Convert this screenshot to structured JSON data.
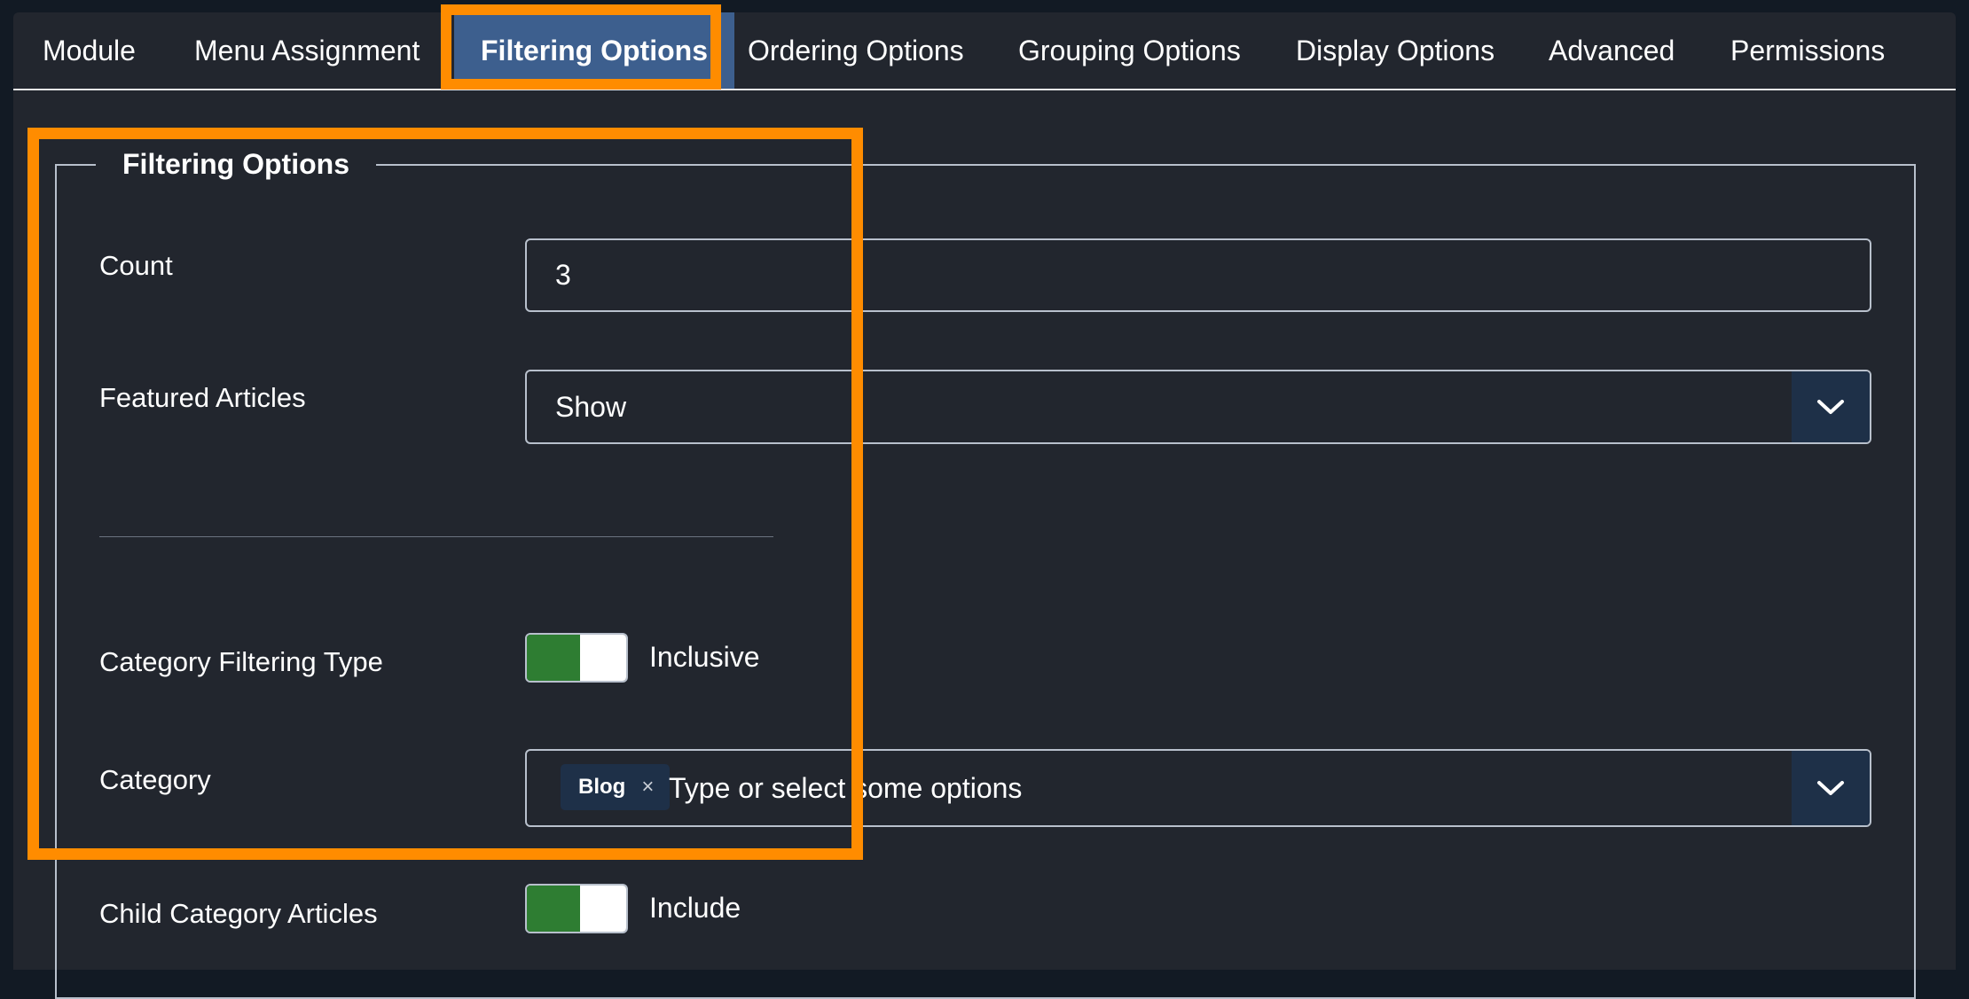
{
  "tabs": [
    {
      "label": "Module"
    },
    {
      "label": "Menu Assignment"
    },
    {
      "label": "Filtering Options",
      "active": true
    },
    {
      "label": "Ordering Options"
    },
    {
      "label": "Grouping Options"
    },
    {
      "label": "Display Options"
    },
    {
      "label": "Advanced"
    },
    {
      "label": "Permissions"
    }
  ],
  "fieldset": {
    "legend": "Filtering Options",
    "count": {
      "label": "Count",
      "value": "3"
    },
    "featured": {
      "label": "Featured Articles",
      "value": "Show"
    },
    "category_filtering_type": {
      "label": "Category Filtering Type",
      "state": "Inclusive"
    },
    "category": {
      "label": "Category",
      "chip": "Blog",
      "chip_remove": "×",
      "placeholder": "Type or select some options"
    },
    "child_category": {
      "label": "Child Category Articles",
      "state": "Include"
    }
  },
  "colors": {
    "highlight": "#ff8c00",
    "active_tab": "#3d5f8e",
    "toggle_on": "#2e7d32"
  }
}
